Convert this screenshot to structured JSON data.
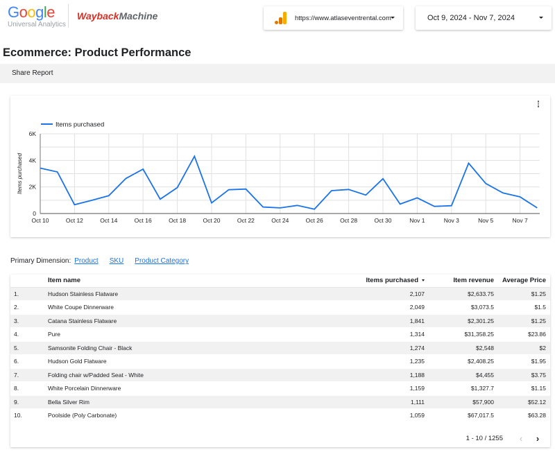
{
  "header": {
    "google_logo_letters": [
      "G",
      "o",
      "o",
      "g",
      "l",
      "e"
    ],
    "google_logo_colors": [
      "#4285F4",
      "#EA4335",
      "#FBBC05",
      "#4285F4",
      "#34A853",
      "#EA4335"
    ],
    "analytics_label": "Universal Analytics",
    "wayback_part1": "Wayback",
    "wayback_part2": "Machine",
    "property_selector": {
      "icon": "google-analytics-icon",
      "value": "https://www.atlaseventrental.com"
    },
    "date_selector": {
      "value": "Oct 9, 2024 - Nov 7, 2024"
    }
  },
  "page_title": "Ecommerce: Product Performance",
  "toolbar": {
    "share_label": "Share Report"
  },
  "chart_data": {
    "type": "line",
    "title": "",
    "legend": [
      "Items purchased"
    ],
    "legend_position": "top-left",
    "xlabel": "",
    "ylabel": "Items purchased",
    "ylim": [
      0,
      6000
    ],
    "yticks": [
      0,
      2000,
      4000,
      6000
    ],
    "ytick_labels": [
      "0",
      "2K",
      "4K",
      "6K"
    ],
    "xtick_labels": [
      "Oct 10",
      "Oct 12",
      "Oct 14",
      "Oct 16",
      "Oct 18",
      "Oct 20",
      "Oct 22",
      "Oct 24",
      "Oct 26",
      "Oct 28",
      "Oct 30",
      "Nov 1",
      "Nov 3",
      "Nov 5",
      "Nov 7"
    ],
    "grid": true,
    "line_color": "#1a73e8",
    "x": [
      "Oct 10",
      "Oct 11",
      "Oct 12",
      "Oct 13",
      "Oct 14",
      "Oct 15",
      "Oct 16",
      "Oct 17",
      "Oct 18",
      "Oct 19",
      "Oct 20",
      "Oct 21",
      "Oct 22",
      "Oct 23",
      "Oct 24",
      "Oct 25",
      "Oct 26",
      "Oct 27",
      "Oct 28",
      "Oct 29",
      "Oct 30",
      "Oct 31",
      "Nov 1",
      "Nov 2",
      "Nov 3",
      "Nov 4",
      "Nov 5",
      "Nov 6",
      "Nov 7",
      "Nov 8"
    ],
    "series": [
      {
        "name": "Items purchased",
        "values": [
          3420,
          3130,
          660,
          990,
          1340,
          2640,
          3340,
          1080,
          1950,
          4310,
          800,
          1790,
          1840,
          490,
          420,
          610,
          330,
          1720,
          1810,
          1390,
          2620,
          710,
          1180,
          540,
          590,
          3790,
          2260,
          1550,
          1250,
          420
        ]
      }
    ]
  },
  "primary_dimension": {
    "label": "Primary Dimension:",
    "options": [
      "Product",
      "SKU",
      "Product Category"
    ]
  },
  "table": {
    "columns": [
      "",
      "Item name",
      "Items purchased",
      "Item revenue",
      "Average Price"
    ],
    "sorted_column": "Items purchased",
    "rows": [
      {
        "idx": "1.",
        "name": "Hudson Stainless Flatware",
        "items": "2,107",
        "revenue": "$2,633.75",
        "avg": "$1.25"
      },
      {
        "idx": "2.",
        "name": "White Coupe Dinnerware",
        "items": "2,049",
        "revenue": "$3,073.5",
        "avg": "$1.5"
      },
      {
        "idx": "3.",
        "name": "Catana Stainless Flatware",
        "items": "1,841",
        "revenue": "$2,301.25",
        "avg": "$1.25"
      },
      {
        "idx": "4.",
        "name": "Pure",
        "items": "1,314",
        "revenue": "$31,358.25",
        "avg": "$23.86"
      },
      {
        "idx": "5.",
        "name": "Samsonite Folding Chair - Black",
        "items": "1,274",
        "revenue": "$2,548",
        "avg": "$2"
      },
      {
        "idx": "6.",
        "name": "Hudson Gold Flatware",
        "items": "1,235",
        "revenue": "$2,408.25",
        "avg": "$1.95"
      },
      {
        "idx": "7.",
        "name": "Folding chair w/Padded Seat - White",
        "items": "1,188",
        "revenue": "$4,455",
        "avg": "$3.75"
      },
      {
        "idx": "8.",
        "name": "White Porcelain Dinnerware",
        "items": "1,159",
        "revenue": "$1,327.7",
        "avg": "$1.15"
      },
      {
        "idx": "9.",
        "name": "Bella Silver Rim",
        "items": "1,111",
        "revenue": "$57,900",
        "avg": "$52.12"
      },
      {
        "idx": "10.",
        "name": "Poolside (Poly Carbonate)",
        "items": "1,059",
        "revenue": "$67,017.5",
        "avg": "$63.28"
      }
    ],
    "pagination": {
      "range": "1 - 10 / 1255",
      "prev_icon": "chevron-left-icon",
      "next_icon": "chevron-right-icon"
    }
  }
}
